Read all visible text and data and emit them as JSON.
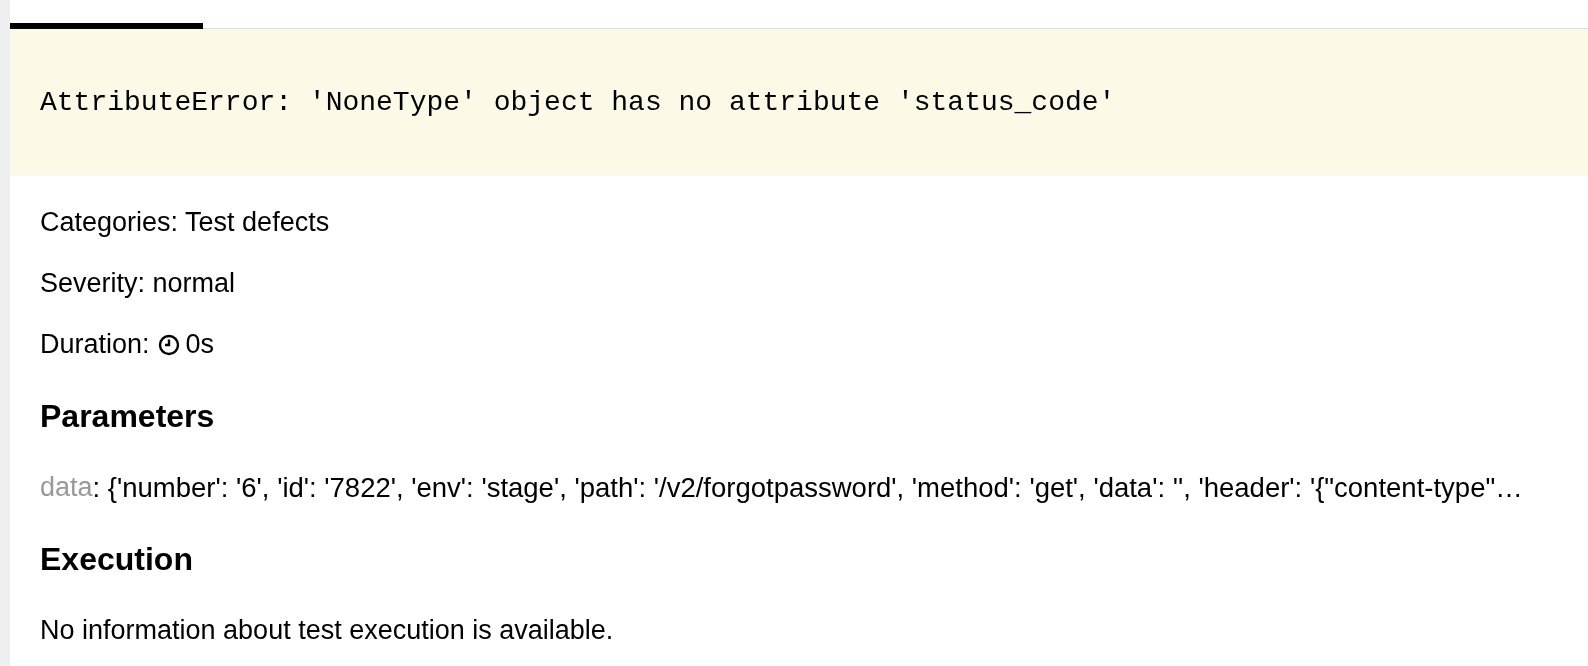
{
  "tabs": [
    {
      "selected": true
    }
  ],
  "error_message": "AttributeError: 'NoneType' object has no attribute 'status_code'",
  "categories": "Categories: Test defects",
  "severity": "Severity: normal",
  "duration": {
    "label": "Duration:",
    "value": "0s"
  },
  "parameters": {
    "heading": "Parameters",
    "items": [
      {
        "name": "data",
        "value": ": {'number': '6', 'id': '7822', 'env': 'stage', 'path': '/v2/forgotpassword', 'method': 'get', 'data': '', 'header': '{\"content-type\"…"
      }
    ]
  },
  "execution": {
    "heading": "Execution",
    "text": "No information about test execution is available."
  }
}
